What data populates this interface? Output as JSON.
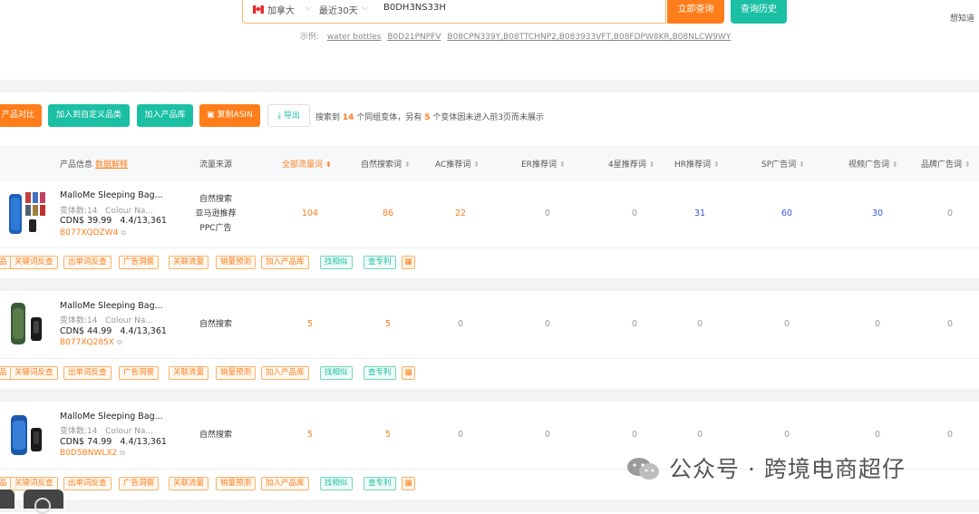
{
  "search": {
    "country": "加拿大",
    "period": "最近30天",
    "query": "B0DH3NS33H",
    "search_button": "立即查询",
    "history_button": "查询历史",
    "examples_label": "示例:",
    "examples": [
      "water bottles",
      "B0D21PNPFV",
      "B08CPN339Y,B08TTCHNP2,B083933VFT,B08FDPW8KR,B08NLCW9WY"
    ],
    "top_right_link": "想知道"
  },
  "toolbar": {
    "compare": "产品对比",
    "add_custom_category": "加入到自定义品类",
    "add_product_library": "加入产品库",
    "copy_asin": "复制ASIN",
    "export": "导出",
    "info_prefix": "搜索到",
    "info_count": "14",
    "info_mid": "个同组变体，另有",
    "info_count2": "5",
    "info_suffix": "个变体因未进入前3页而未展示"
  },
  "table": {
    "headers": {
      "product_info": "产品信息",
      "data_help": "数据解释",
      "traffic_source": "流量来源",
      "all_keywords": "全部流量词",
      "organic": "自然搜索词",
      "ac": "AC推荐词",
      "er": "ER推荐词",
      "star4": "4星推荐词",
      "hr": "HR推荐词",
      "sp": "SP广告词",
      "video": "视频广告词",
      "brand": "品牌广告词"
    },
    "rows": [
      {
        "title": "MalloMe Sleeping Bag...",
        "variants": "变体数:14",
        "colour": "Colour Na...",
        "price": "CDN$ 39.99",
        "rating": "4.4/13,361",
        "asin": "B077XQDZW4",
        "sources": [
          "自然搜索",
          "亚马逊推荐",
          "PPC广告"
        ],
        "values": [
          "104",
          "86",
          "22",
          "0",
          "0",
          "31",
          "60",
          "30",
          "0"
        ]
      },
      {
        "title": "MalloMe Sleeping Bag...",
        "variants": "变体数:14",
        "colour": "Colour Na...",
        "price": "CDN$ 44.99",
        "rating": "4.4/13,361",
        "asin": "B077XQ285X",
        "sources": [
          "自然搜索"
        ],
        "values": [
          "5",
          "5",
          "0",
          "0",
          "0",
          "0",
          "0",
          "0",
          "0"
        ]
      },
      {
        "title": "MalloMe Sleeping Bag...",
        "variants": "变体数:14",
        "colour": "Colour Na...",
        "price": "CDN$ 74.99",
        "rating": "4.4/13,361",
        "asin": "B0D5BNWLX2",
        "sources": [
          "自然搜索"
        ],
        "values": [
          "5",
          "5",
          "0",
          "0",
          "0",
          "0",
          "0",
          "0",
          "0"
        ]
      }
    ],
    "row_tags": {
      "cut_first": "品",
      "keyword_reverse": "关键词反查",
      "order_keyword_reverse": "出单词反查",
      "ad_insight": "广告洞察",
      "related_traffic": "关联流量",
      "sales_forecast": "销量预测",
      "add_library": "加入产品库",
      "find_similar": "找相似",
      "check_patent": "查专利"
    }
  },
  "watermark": "公众号 · 跨境电商超仔",
  "colors": {
    "orange": "#ff7d1a",
    "teal": "#1bbfa4",
    "blue": "#3355dd"
  }
}
